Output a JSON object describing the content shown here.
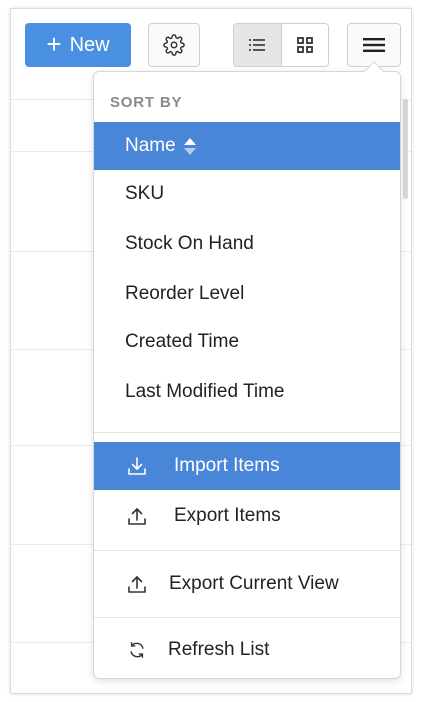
{
  "toolbar": {
    "new_label": "New",
    "new_icon": "plus-icon",
    "settings_icon": "gear-icon",
    "list_view_icon": "list-view-icon",
    "grid_view_icon": "grid-view-icon",
    "menu_icon": "hamburger-menu-icon"
  },
  "menu": {
    "sort_header": "SORT BY",
    "sort_items": [
      {
        "label": "Name",
        "selected": true
      },
      {
        "label": "SKU"
      },
      {
        "label": "Stock On Hand"
      },
      {
        "label": "Reorder Level"
      },
      {
        "label": "Created Time"
      },
      {
        "label": "Last Modified Time"
      }
    ],
    "actions": [
      {
        "label": "Import Items",
        "icon": "import-icon",
        "selected": true
      },
      {
        "label": "Export Items",
        "icon": "export-icon"
      },
      {
        "label": "Export Current View",
        "icon": "export-icon"
      },
      {
        "label": "Refresh List",
        "icon": "refresh-icon"
      }
    ]
  },
  "colors": {
    "accent": "#4a90e2",
    "selected_bg": "#4a86d8",
    "header_text": "#8a8a8a"
  }
}
